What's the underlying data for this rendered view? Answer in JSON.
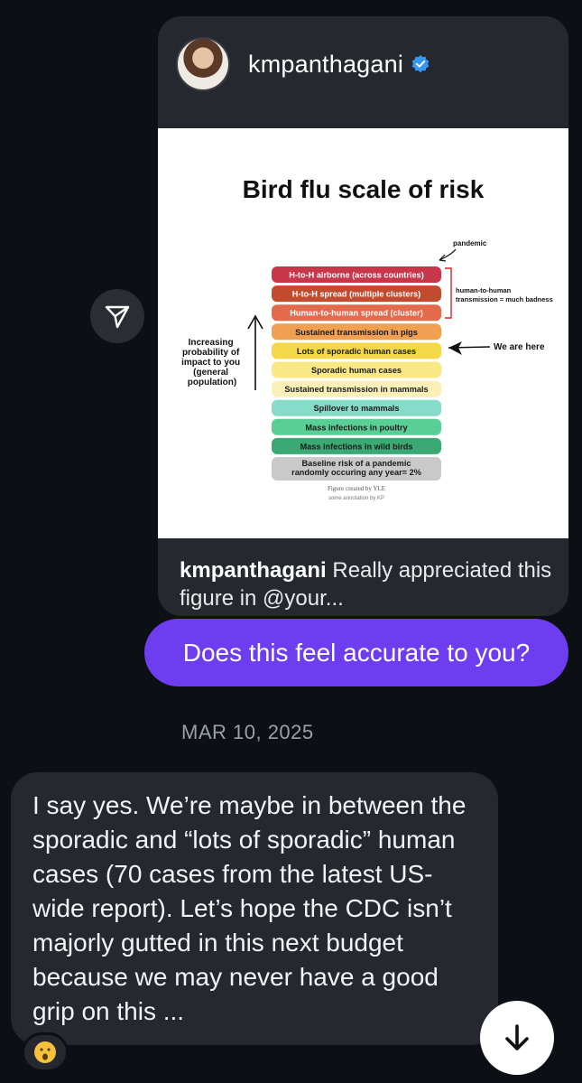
{
  "shared_post": {
    "username": "kmpanthagani",
    "verified": true,
    "caption_user": "kmpanthagani",
    "caption_text": "Really appreciated this figure in @your...",
    "figure": {
      "title": "Bird flu scale of risk",
      "pandemic_label": "pandemic",
      "h2h_note": "human-to-human transmission = much badness",
      "axis_label": "Increasing probability of impact to you (general population)",
      "here_label": "We are here",
      "credit": "Figure created by YLE",
      "credit_sub": "some annotation by KP",
      "levels": [
        {
          "label": "H-to-H airborne (across countries)",
          "color": "#c8364a"
        },
        {
          "label": "H-to-H spread  (multiple clusters)",
          "color": "#c24a2e"
        },
        {
          "label": "Human-to-human spread (cluster)",
          "color": "#e36a4a"
        },
        {
          "label": "Sustained transmission in pigs",
          "color": "#f0a050"
        },
        {
          "label": "Lots of sporadic human cases",
          "color": "#f5d84a"
        },
        {
          "label": "Sporadic human cases",
          "color": "#f9e884"
        },
        {
          "label": "Sustained transmission in mammals",
          "color": "#fbf0b8"
        },
        {
          "label": "Spillover to mammals",
          "color": "#86dcc8"
        },
        {
          "label": "Mass infections in poultry",
          "color": "#5acf95"
        },
        {
          "label": "Mass infections in wild birds",
          "color": "#3aa973"
        },
        {
          "label": "Baseline risk of a pandemic randomly occuring any year= 2%",
          "color": "#c9c9c9"
        }
      ]
    }
  },
  "sent_message": "Does this feel accurate to you?",
  "date_separator": "MAR 10, 2025",
  "received_message": "I say yes. We’re maybe in between the sporadic and “lots of sporadic” human cases (70 cases from the latest US-wide report). Let’s hope the CDC isn’t majorly gutted in this next budget because we may never have a good grip on this ...",
  "reaction_emoji": "😮",
  "icons": {
    "share": "send-icon",
    "verified": "verified-badge-icon",
    "scroll": "arrow-down-icon"
  },
  "colors": {
    "background": "#0c0f14",
    "bubble": "#25282e",
    "sent_bubble": "#6e3df0",
    "verified": "#3897f0"
  }
}
